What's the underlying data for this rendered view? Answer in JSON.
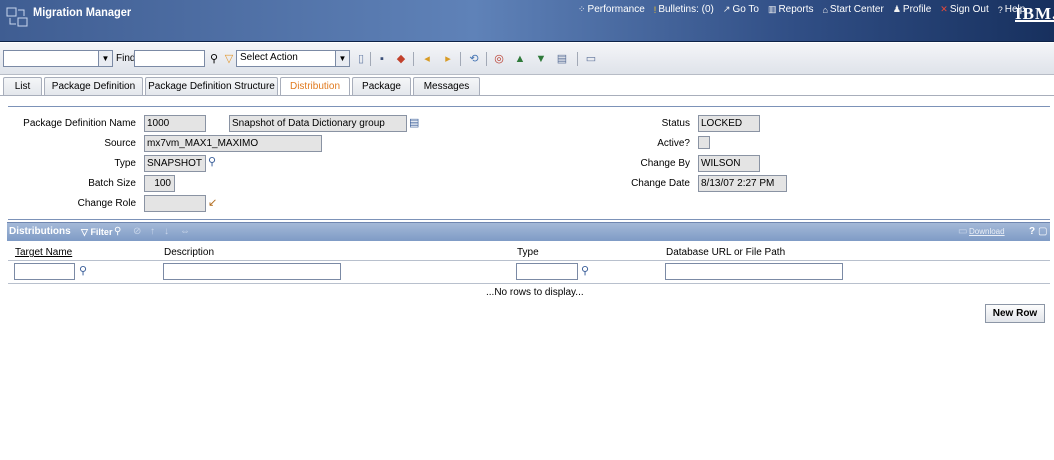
{
  "app": {
    "title": "Migration Manager",
    "brand": "IBM."
  },
  "nav": [
    {
      "label": "Performance",
      "icon": "performance-icon",
      "glyph": "⁘"
    },
    {
      "label": "Bulletins: (0)",
      "icon": "bulletin-icon",
      "glyph": "!"
    },
    {
      "label": "Go To",
      "icon": "goto-icon",
      "glyph": "↗"
    },
    {
      "label": "Reports",
      "icon": "reports-icon",
      "glyph": "▥"
    },
    {
      "label": "Start Center",
      "icon": "home-icon",
      "glyph": "⌂"
    },
    {
      "label": "Profile",
      "icon": "profile-icon",
      "glyph": "♟"
    },
    {
      "label": "Sign Out",
      "icon": "signout-icon",
      "glyph": "✕"
    },
    {
      "label": "Help",
      "icon": "help-icon",
      "glyph": "?"
    }
  ],
  "toolbar": {
    "query_value": "",
    "find_label": "Find:",
    "find_value": "",
    "action_value": "Select Action"
  },
  "tabs": [
    "List",
    "Package Definition",
    "Package Definition Structure",
    "Distribution",
    "Package",
    "Messages"
  ],
  "active_tab": "Distribution",
  "header": {
    "package_name_label": "Package Definition Name",
    "package_name": "1000",
    "package_desc": "Snapshot of Data Dictionary group",
    "source_label": "Source",
    "source": "mx7vm_MAX1_MAXIMO",
    "type_label": "Type",
    "type": "SNAPSHOT",
    "batch_label": "Batch Size",
    "batch": "100",
    "role_label": "Change Role",
    "role": "",
    "status_label": "Status",
    "status": "LOCKED",
    "active_label": "Active?",
    "changeby_label": "Change By",
    "changeby": "WILSON",
    "changedate_label": "Change Date",
    "changedate": "8/13/07 2:27 PM"
  },
  "distributions": {
    "title": "Distributions",
    "filter_label": "Filter",
    "download_label": "Download",
    "help_label": "?",
    "columns": [
      "Target Name",
      "Description",
      "Type",
      "Database URL or File Path"
    ],
    "empty_text": "...No rows to display...",
    "new_row_label": "New Row"
  },
  "colors": {
    "banner": "#3f5d92",
    "active_tab": "#e07a1f",
    "table_header": "#8aa5cd"
  }
}
